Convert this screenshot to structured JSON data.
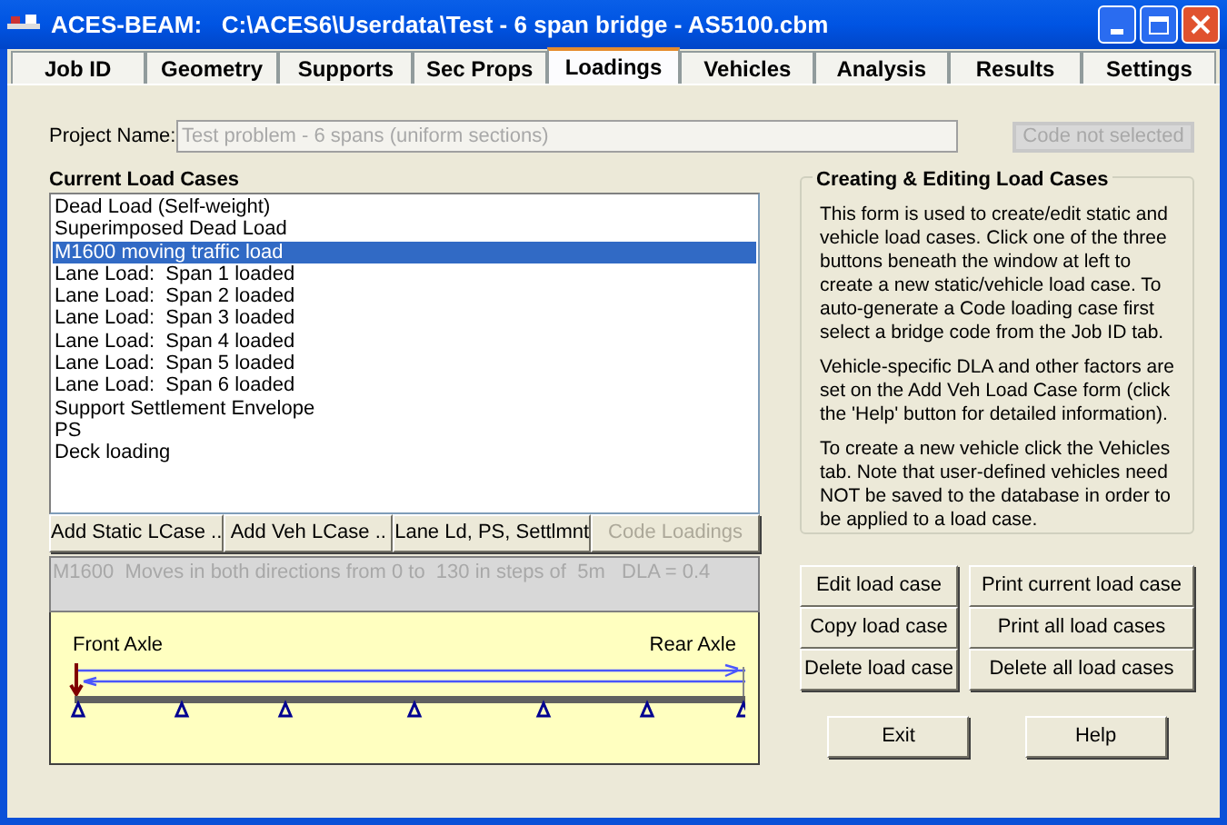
{
  "window": {
    "title": "ACES-BEAM:   C:\\ACES6\\Userdata\\Test - 6 span bridge - AS5100.cbm"
  },
  "tabs": [
    {
      "label": "Job ID",
      "selected": false
    },
    {
      "label": "Geometry",
      "selected": false
    },
    {
      "label": "Supports",
      "selected": false
    },
    {
      "label": "Sec Props",
      "selected": false
    },
    {
      "label": "Loadings",
      "selected": true
    },
    {
      "label": "Vehicles",
      "selected": false
    },
    {
      "label": "Analysis",
      "selected": false
    },
    {
      "label": "Results",
      "selected": false
    },
    {
      "label": "Settings",
      "selected": false
    }
  ],
  "project": {
    "label": "Project Name:",
    "value": "Test problem - 6 spans (uniform sections)",
    "disabled": true
  },
  "code_status": "Code not selected",
  "load_cases": {
    "title": "Current Load Cases",
    "items": [
      {
        "label": "Dead Load (Self-weight)",
        "selected": false
      },
      {
        "label": "Superimposed Dead Load",
        "selected": false
      },
      {
        "label": "M1600 moving traffic load",
        "selected": true
      },
      {
        "label": "Lane Load:  Span 1 loaded",
        "selected": false
      },
      {
        "label": "Lane Load:  Span 2 loaded",
        "selected": false
      },
      {
        "label": "Lane Load:  Span 3 loaded",
        "selected": false
      },
      {
        "label": "Lane Load:  Span 4 loaded",
        "selected": false
      },
      {
        "label": "Lane Load:  Span 5 loaded",
        "selected": false
      },
      {
        "label": "Lane Load:  Span 6 loaded",
        "selected": false
      },
      {
        "label": "Support Settlement Envelope",
        "selected": false
      },
      {
        "label": "PS",
        "selected": false
      },
      {
        "label": "Deck loading",
        "selected": false
      }
    ]
  },
  "add_buttons": [
    {
      "label": "Add Static LCase ..",
      "disabled": false
    },
    {
      "label": "Add Veh LCase ..",
      "disabled": false
    },
    {
      "label": "Lane Ld, PS, Settlmnt",
      "disabled": false
    },
    {
      "label": "Code Loadings",
      "disabled": true
    }
  ],
  "description": "M1600  Moves in both directions from 0 to  130 in steps of  5m   DLA = 0.4",
  "diagram": {
    "front_label": "Front Axle",
    "rear_label": "Rear Axle"
  },
  "info": {
    "title": "Creating & Editing Load Cases",
    "paragraphs": [
      "This form is used to create/edit static and vehicle load cases.  Click one of the three buttons beneath the window at left  to create a new static/vehicle load case.  To auto-generate a Code loading case first select a bridge code from the Job ID tab.",
      "Vehicle-specific DLA and other factors are set on the Add Veh Load Case form (click the 'Help' button for detailed information).",
      "To create a new vehicle click the Vehicles tab.  Note that user-defined vehicles need NOT be saved to the database in order to be applied to a load case."
    ]
  },
  "action_buttons": [
    "Edit load case",
    "Print current load case",
    "Copy load case",
    "Print all load cases",
    "Delete load case",
    "Delete all load cases"
  ],
  "footer_buttons": [
    "Exit",
    "Help"
  ]
}
